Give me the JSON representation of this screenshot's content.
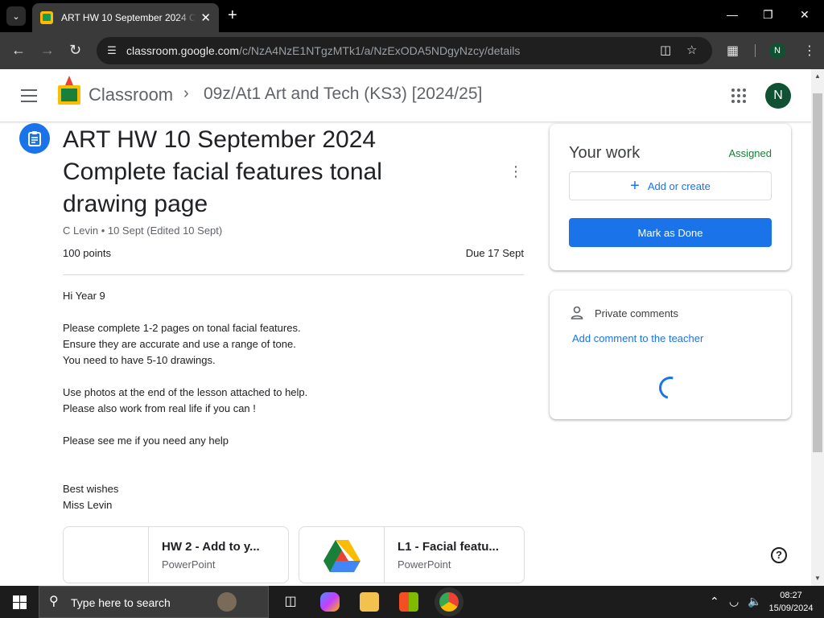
{
  "browser": {
    "tab_title": "ART HW 10 September 2024 Complete facial features tonal drawing page",
    "url_host": "classroom.google.com",
    "url_path": "/c/NzA4NzE1NTgzMTk1/a/NzExODA5NDgyNzcy/details",
    "profile_initial": "N"
  },
  "appbar": {
    "brand": "Classroom",
    "breadcrumb": "09z/At1 Art and Tech (KS3) [2024/25]",
    "avatar_initial": "N"
  },
  "assignment": {
    "title": "ART HW 10 September 2024 Complete facial features tonal drawing page",
    "meta": "C Levin • 10 Sept (Edited 10 Sept)",
    "points": "100 points",
    "due": "Due 17 Sept",
    "description": "Hi Year 9\n\nPlease complete 1-2 pages on tonal facial features.\nEnsure they are accurate and use a range of tone.\nYou need to have 5-10 drawings.\n\nUse photos at the end of the lesson attached to help.\nPlease also work from real life if you can !\n\nPlease see me if you need any help\n\n\nBest wishes\nMiss Levin",
    "attachments": [
      {
        "title": "HW 2 - Add to y...",
        "type": "PowerPoint"
      },
      {
        "title": "L1 - Facial featu...",
        "type": "PowerPoint"
      }
    ]
  },
  "your_work": {
    "title": "Your work",
    "status": "Assigned",
    "add_label": "Add or create",
    "done_label": "Mark as Done"
  },
  "private_comments": {
    "title": "Private comments",
    "link": "Add comment to the teacher"
  },
  "taskbar": {
    "search_placeholder": "Type here to search",
    "time": "08:27",
    "date": "15/09/2024"
  },
  "colors": {
    "accent": "#1a73e8",
    "status_green": "#188038"
  }
}
